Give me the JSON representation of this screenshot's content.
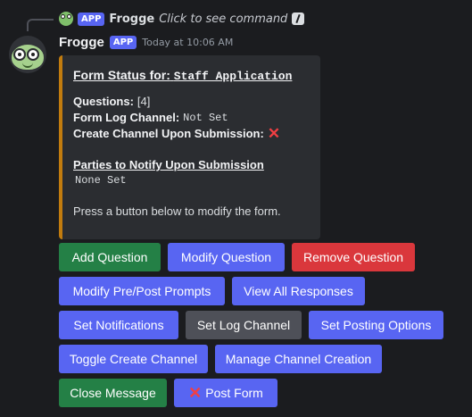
{
  "reply": {
    "app_badge": "APP",
    "author": "Frogge",
    "command_text": "Click to see command"
  },
  "message": {
    "author": "Frogge",
    "app_badge": "APP",
    "timestamp": "Today at 10:06 AM"
  },
  "embed": {
    "accent_color": "#c27c0e",
    "title_prefix": "Form Status for:",
    "title_form_name": "Staff_Application",
    "questions_label": "Questions:",
    "questions_value": "[4]",
    "log_channel_label": "Form Log Channel:",
    "log_channel_value": "Not Set",
    "create_channel_label": "Create Channel Upon Submission:",
    "create_channel_icon": "cross-mark",
    "parties_heading": "Parties to Notify Upon Submission",
    "parties_value": "None Set",
    "footer": "Press a button below to modify the form."
  },
  "buttons": {
    "add_question": "Add Question",
    "modify_question": "Modify Question",
    "remove_question": "Remove Question",
    "modify_prompts": "Modify Pre/Post Prompts",
    "view_responses": "View All Responses",
    "set_notifications": "Set Notifications",
    "set_log_channel": "Set Log Channel",
    "set_posting_options": "Set Posting Options",
    "toggle_create_channel": "Toggle Create Channel",
    "manage_channel_creation": "Manage Channel Creation",
    "close_message": "Close Message",
    "post_form": "Post Form"
  },
  "colors": {
    "success": "#248046",
    "primary": "#5865f2",
    "danger": "#da373c",
    "secondary": "#4e5058",
    "cross": "#f23f43"
  }
}
